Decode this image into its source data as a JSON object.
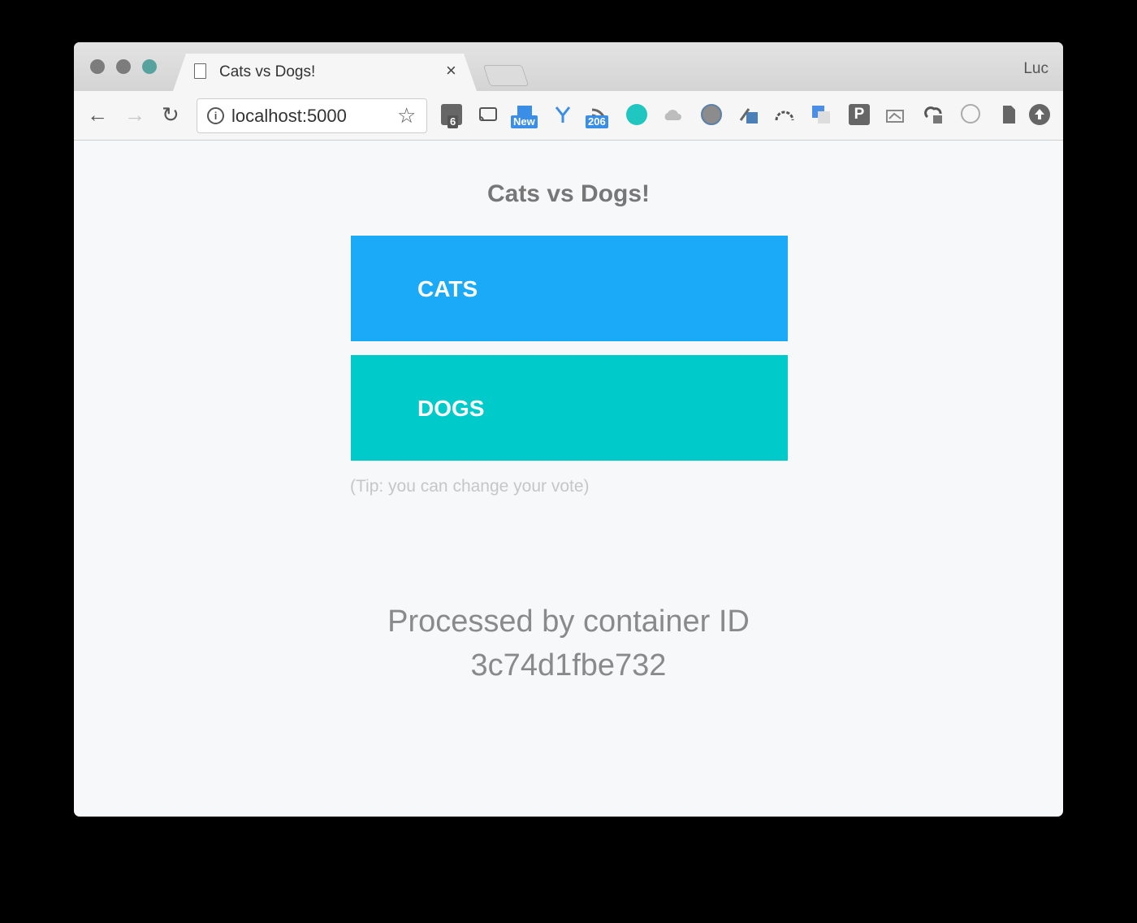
{
  "browser": {
    "tab_title": "Cats vs Dogs!",
    "tab_close": "×",
    "profile_name": "Luc",
    "back": "←",
    "forward": "→",
    "reload": "↻",
    "info_glyph": "i",
    "url": "localhost:5000",
    "bookmark": "☆",
    "extensions": [
      {
        "name": "tab-counter-icon",
        "badge": "6"
      },
      {
        "name": "cast-icon"
      },
      {
        "name": "new-extension-icon",
        "badge": "New"
      },
      {
        "name": "y-extension-icon"
      },
      {
        "name": "feed-icon",
        "badge": "206"
      },
      {
        "name": "teal-circle-icon"
      },
      {
        "name": "cloud-icon"
      },
      {
        "name": "globe-icon"
      },
      {
        "name": "share-icon"
      },
      {
        "name": "gauge-icon"
      },
      {
        "name": "translate-icon"
      },
      {
        "name": "p-icon",
        "label": "P"
      },
      {
        "name": "image-icon"
      },
      {
        "name": "cloud-lock-icon"
      },
      {
        "name": "circle-info-icon"
      },
      {
        "name": "document-icon"
      },
      {
        "name": "upload-icon"
      }
    ]
  },
  "page": {
    "title": "Cats vs Dogs!",
    "option_a": "CATS",
    "option_b": "DOGS",
    "tip": "(Tip: you can change your vote)",
    "processed_by": "Processed by container ID",
    "container_id": "3c74d1fbe732"
  },
  "colors": {
    "cats": "#1aaaf8",
    "dogs": "#00cbca"
  }
}
